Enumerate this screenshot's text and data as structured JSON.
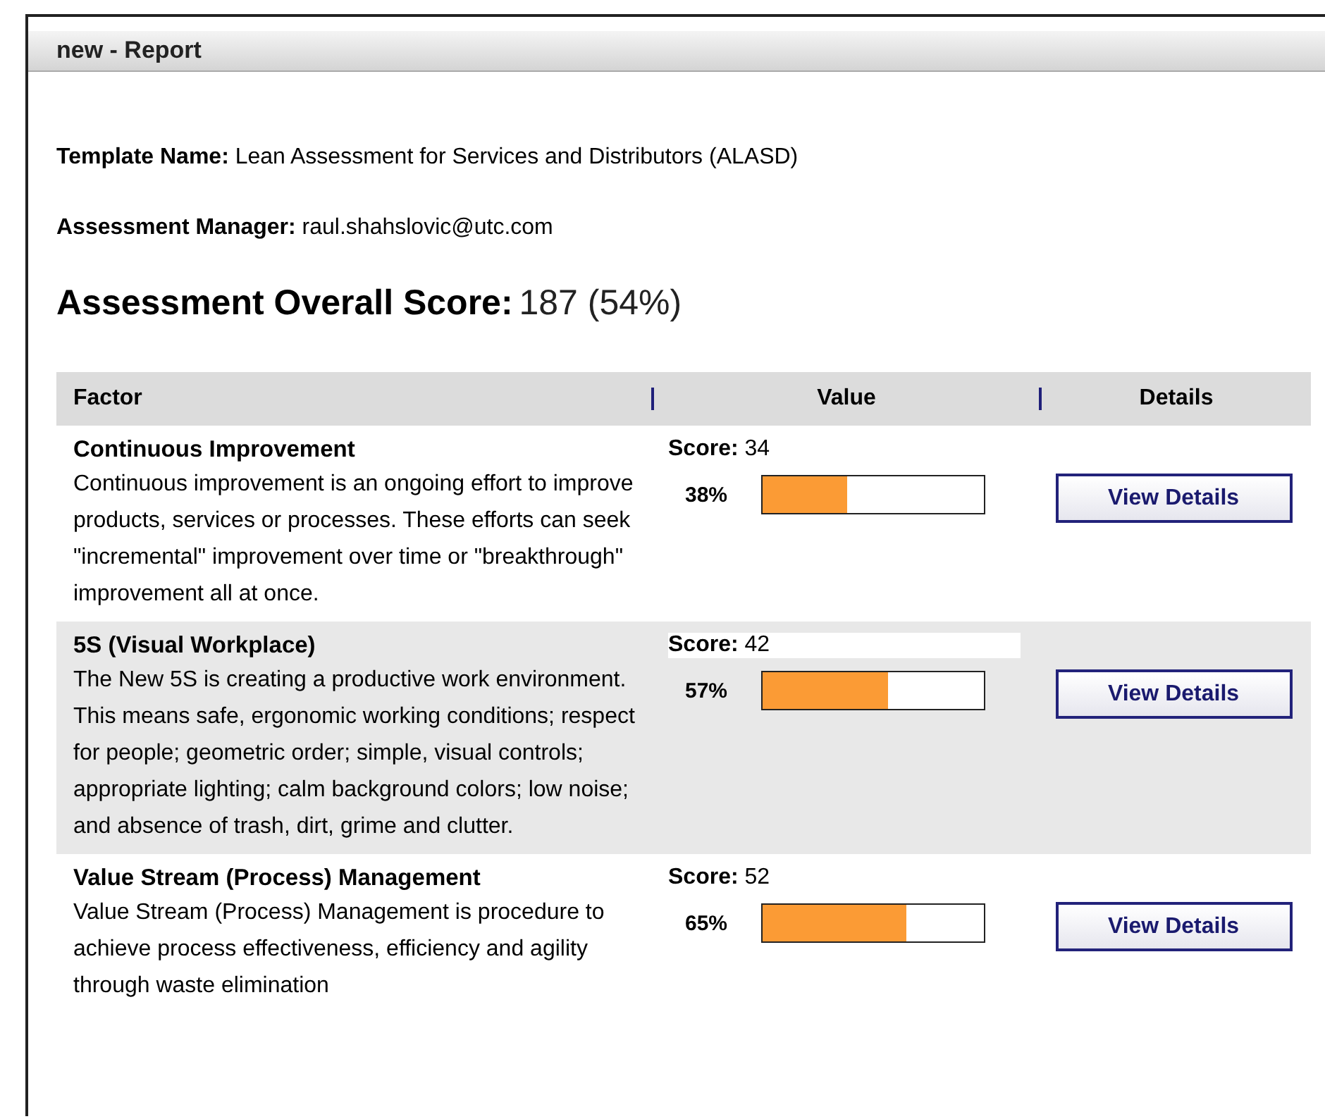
{
  "window": {
    "title": "new - Report"
  },
  "template_name": "**Template Name:** Lean Assessment for Services and Distributors (ALASD)",
  "assessment_manager": "**Assessment Manager:** raul.shahslovic@utc.com",
  "overall_score": {
    "label": "Assessment Overall Score:",
    "value": "187 (54%)"
  },
  "table": {
    "columns": [
      "Factor",
      "Value",
      "Details"
    ],
    "rows": [
      {
        "factor": "Continuous Improvement",
        "description": "Continuous improvement is an ongoing effort to improve products, services or processes. These efforts can seek \"incremental\" improvement over time or \"breakthrough\" improvement all at once.",
        "score": "**Score:** 34",
        "percent": "38%",
        "level": 0.38,
        "button": "View Details"
      },
      {
        "factor": "5S (Visual Workplace)",
        "description": "The New 5S is creating a productive work environment. This means safe, ergonomic working conditions; respect for people; geometric order; simple, visual controls; appropriate lighting; calm background colors; low noise; and absence of trash, dirt, grime and clutter.",
        "score": "**Score:** 42",
        "percent": "57%",
        "level": 0.57,
        "button": "View Details"
      },
      {
        "factor": "Value Stream (Process) Management",
        "description": "Value Stream (Process) Management is procedure to achieve process effectiveness, efficiency and agility through waste elimination",
        "score": "**Score:** 52",
        "percent": "65%",
        "level": 0.65,
        "button": "View Details"
      }
    ]
  }
}
